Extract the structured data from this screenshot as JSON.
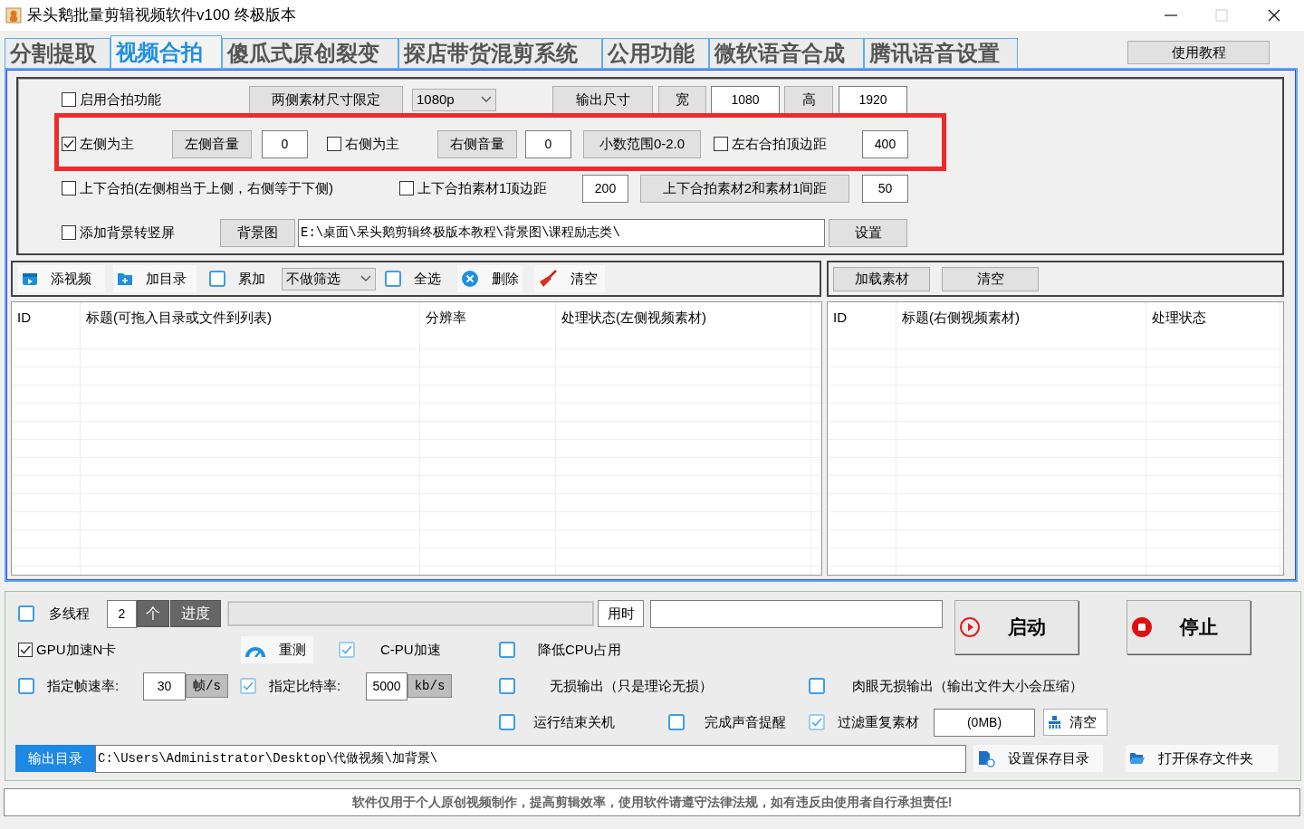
{
  "window": {
    "title": "呆头鹅批量剪辑视频软件v100 终极版本"
  },
  "tabs": [
    {
      "label": "分割提取",
      "selected": false
    },
    {
      "label": "视频合拍",
      "selected": true
    },
    {
      "label": "傻瓜式原创裂变",
      "selected": false
    },
    {
      "label": "探店带货混剪系统",
      "selected": false
    },
    {
      "label": "公用功能",
      "selected": false
    },
    {
      "label": "微软语音合成",
      "selected": false
    },
    {
      "label": "腾讯语音设置",
      "selected": false
    }
  ],
  "help_button": "使用教程",
  "settings_rows": [
    {
      "highlighted": false,
      "items": [
        {
          "kind": "checkbox",
          "label": "启用合拍功能",
          "checked": false
        },
        {
          "kind": "button",
          "label": "两侧素材尺寸限定"
        },
        {
          "kind": "select",
          "value": "1080p"
        },
        {
          "kind": "button",
          "label": "输出尺寸"
        },
        {
          "kind": "button",
          "label": "宽"
        },
        {
          "kind": "field",
          "value": "1080"
        },
        {
          "kind": "button",
          "label": "高"
        },
        {
          "kind": "field",
          "value": "1920"
        }
      ]
    },
    {
      "highlighted": true,
      "items": [
        {
          "kind": "checkbox",
          "label": "左侧为主",
          "checked": true
        },
        {
          "kind": "button",
          "label": "左侧音量"
        },
        {
          "kind": "field",
          "value": "0"
        },
        {
          "kind": "checkbox",
          "label": "右侧为主",
          "checked": false
        },
        {
          "kind": "button",
          "label": "右侧音量"
        },
        {
          "kind": "field",
          "value": "0"
        },
        {
          "kind": "button",
          "label": "小数范围0-2.0"
        },
        {
          "kind": "checkbox",
          "label": "左右合拍顶边距",
          "checked": false
        },
        {
          "kind": "field",
          "value": "400"
        }
      ]
    },
    {
      "highlighted": false,
      "items": [
        {
          "kind": "checkbox",
          "label": "上下合拍(左侧相当于上侧，右侧等于下侧)",
          "checked": false
        },
        {
          "kind": "checkbox",
          "label": "上下合拍素材1顶边距",
          "checked": false
        },
        {
          "kind": "field",
          "value": "200"
        },
        {
          "kind": "button",
          "label": "上下合拍素材2和素材1间距"
        },
        {
          "kind": "field",
          "value": "50"
        }
      ]
    },
    {
      "highlighted": false,
      "items": [
        {
          "kind": "checkbox",
          "label": "添加背景转竖屏",
          "checked": false
        },
        {
          "kind": "button",
          "label": "背景图"
        },
        {
          "kind": "path_field",
          "value": "E:\\桌面\\呆头鹅剪辑终极版本教程\\背景图\\课程励志类\\"
        },
        {
          "kind": "button",
          "label": "设置"
        }
      ]
    }
  ],
  "left_toolbar": [
    {
      "kind": "tool",
      "label": "添视频"
    },
    {
      "kind": "tool",
      "label": "加目录"
    },
    {
      "kind": "flat_checkbox",
      "label": "累加",
      "checked": false
    },
    {
      "kind": "select",
      "value": "不做筛选"
    },
    {
      "kind": "flat_checkbox",
      "label": "全选",
      "checked": false
    },
    {
      "kind": "tool",
      "label": "删除"
    },
    {
      "kind": "tool",
      "label": "清空"
    }
  ],
  "right_toolbar": [
    "加载素材",
    "清空"
  ],
  "left_table": {
    "columns": [
      "ID",
      "标题(可拖入目录或文件到列表)",
      "分辨率",
      "处理状态(左侧视频素材)"
    ]
  },
  "right_table": {
    "columns": [
      "ID",
      "标题(右侧视频素材)",
      "处理状态"
    ]
  },
  "bottom_rows": [
    {
      "items": [
        {
          "kind": "flat_checkbox",
          "label": "多线程",
          "checked": false
        },
        {
          "kind": "field",
          "value": "2"
        },
        {
          "kind": "tag",
          "label": "个"
        },
        {
          "kind": "tag",
          "label": "进度"
        },
        {
          "kind": "progress",
          "level": 0
        },
        {
          "kind": "time_label",
          "label": "用时"
        },
        {
          "kind": "field"
        },
        {
          "kind": "action",
          "label": "启动"
        },
        {
          "kind": "action",
          "label": "停止"
        }
      ]
    },
    {
      "items": [
        {
          "kind": "checkbox",
          "label": "GPU加速N卡",
          "checked": true
        },
        {
          "kind": "tool",
          "label": "重测"
        },
        {
          "kind": "flat_checkbox",
          "label": "C-PU加速",
          "checked": true
        },
        {
          "kind": "flat_checkbox",
          "label": "降低CPU占用",
          "checked": false
        }
      ]
    },
    {
      "items": [
        {
          "kind": "flat_checkbox",
          "label": "指定帧速率:",
          "checked": false
        },
        {
          "kind": "field",
          "value": "30"
        },
        {
          "kind": "unit",
          "label": "帧/s"
        },
        {
          "kind": "flat_checkbox",
          "label": "指定比特率:",
          "checked": true
        },
        {
          "kind": "field",
          "value": "5000"
        },
        {
          "kind": "unit",
          "label": "kb/s"
        },
        {
          "kind": "flat_checkbox",
          "label": "无损输出（只是理论无损）",
          "checked": false
        },
        {
          "kind": "flat_checkbox",
          "label": "肉眼无损输出（输出文件大小会压缩）",
          "checked": false
        }
      ]
    },
    {
      "items": [
        {
          "kind": "flat_checkbox",
          "label": "运行结束关机",
          "checked": false
        },
        {
          "kind": "flat_checkbox",
          "label": "完成声音提醒",
          "checked": false
        },
        {
          "kind": "flat_checkbox",
          "label": "过滤重复素材",
          "checked": true
        },
        {
          "kind": "field",
          "value": "(0MB)"
        },
        {
          "kind": "tool",
          "label": "清空"
        }
      ]
    },
    {
      "items": [
        {
          "kind": "path_label",
          "label": "输出目录"
        },
        {
          "kind": "path_field",
          "value": "C:\\Users\\Administrator\\Desktop\\代做视频\\加背景\\"
        },
        {
          "kind": "tool",
          "label": "设置保存目录"
        },
        {
          "kind": "tool",
          "label": "打开保存文件夹"
        }
      ]
    }
  ],
  "notice": "软件仅用于个人原创视频制作，提高剪辑效率，使用软件请遵守法律法规，如有违反由使用者自行承担责任!"
}
